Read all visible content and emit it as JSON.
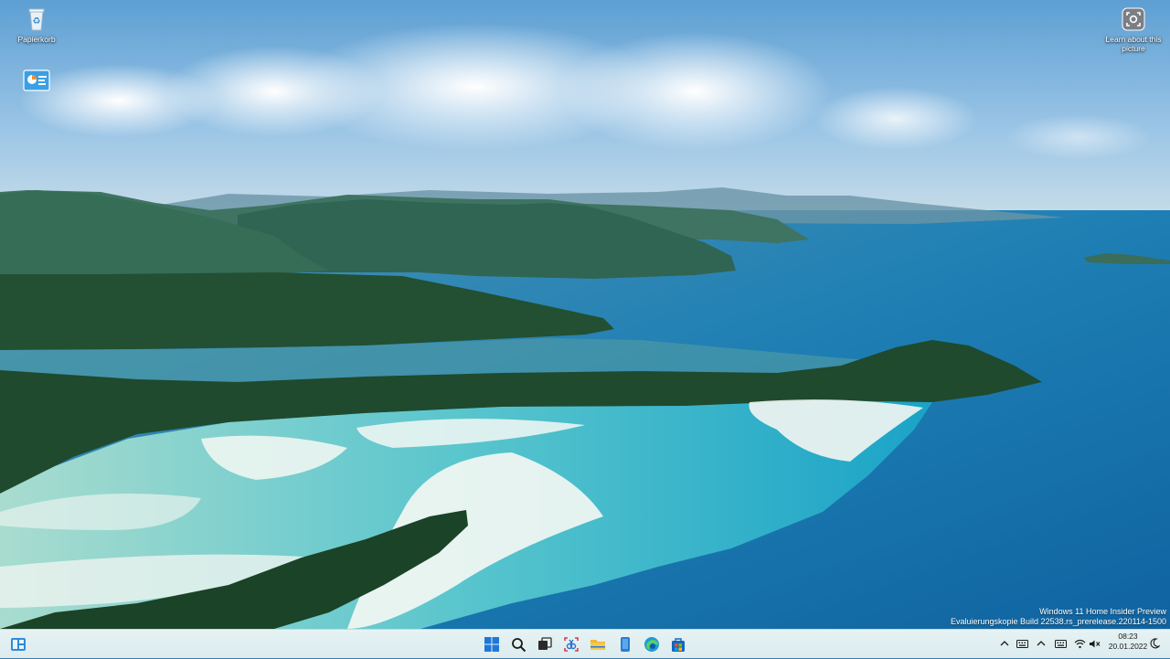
{
  "desktop": {
    "icons": [
      {
        "label": "Papierkorb",
        "icon": "recycle-bin-icon"
      },
      {
        "label": "",
        "icon": "control-panel-shortcut-icon"
      }
    ],
    "spotlight": {
      "label": "Learn about this picture",
      "icon": "camera-lens-icon"
    },
    "watermark": {
      "line1": "Windows 11 Home Insider Preview",
      "line2": "Evaluierungskopie Build 22538.rs_prerelease.220114-1500"
    }
  },
  "taskbar": {
    "left": {
      "icon": "widgets-icon"
    },
    "center": [
      {
        "name": "start",
        "icon": "windows-logo-icon",
        "color": "#1e78d7"
      },
      {
        "name": "search",
        "icon": "search-icon"
      },
      {
        "name": "task-view",
        "icon": "task-view-icon"
      },
      {
        "name": "snipping",
        "icon": "snipping-tool-icon"
      },
      {
        "name": "explorer",
        "icon": "folder-icon",
        "color": "#f2b632"
      },
      {
        "name": "notepad",
        "icon": "phone-icon"
      },
      {
        "name": "edge",
        "icon": "edge-icon",
        "color": "#1e9bd7"
      },
      {
        "name": "store",
        "icon": "store-icon",
        "color": "#1565c0"
      }
    ],
    "tray": {
      "icons": [
        "chevron-up-icon",
        "keyboard-icon",
        "chevron-up-icon",
        "keyboard-icon",
        "wifi-icon",
        "volume-muted-icon"
      ],
      "time": "08:23",
      "date": "20.01.2022",
      "notification_icon": "moon-icon"
    }
  }
}
